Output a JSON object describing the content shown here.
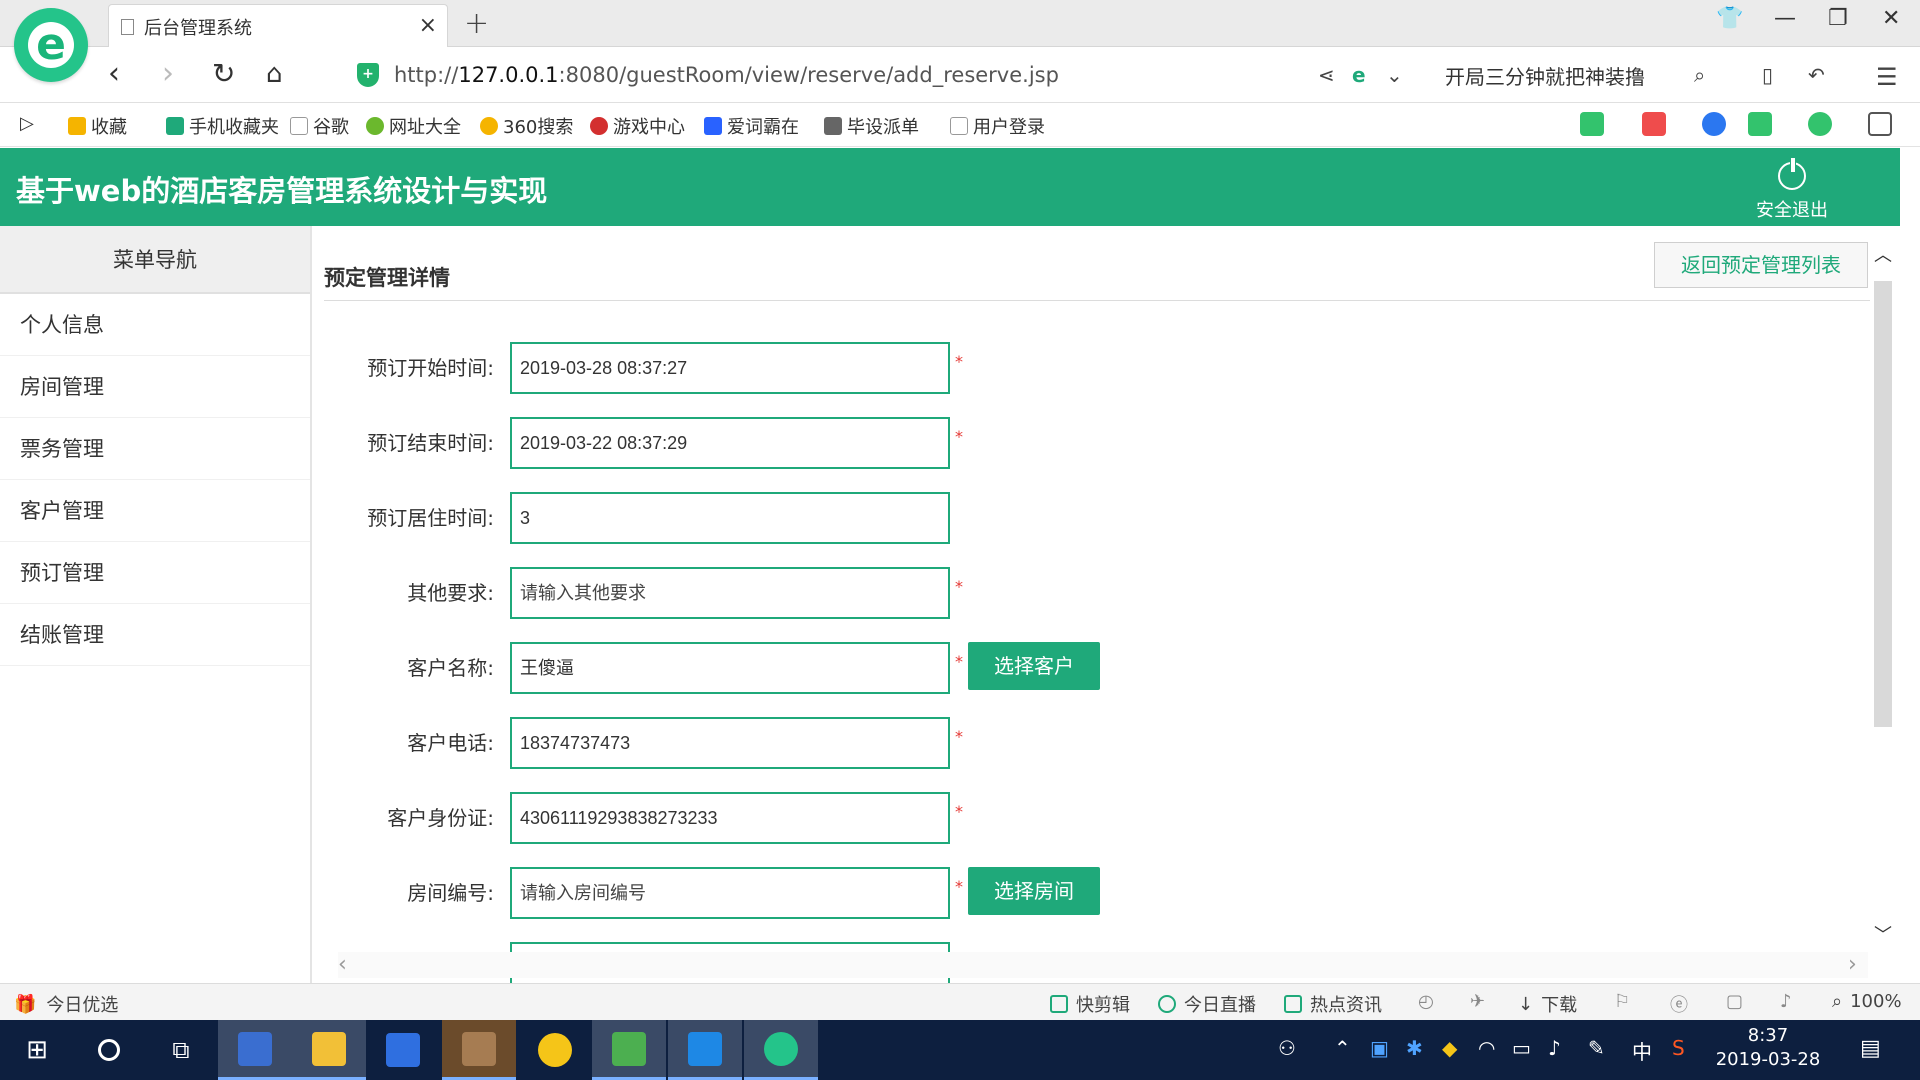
{
  "browser": {
    "tab_title": "后台管理系统",
    "url_prefix": "http://",
    "url_host": "127.0.0.1",
    "url_rest": ":8080/guestRoom/view/reserve/add_reserve.jsp",
    "promo_text": "开局三分钟就把神装撸",
    "favorites": [
      "收藏",
      "手机收藏夹",
      "谷歌",
      "网址大全",
      "360搜索",
      "游戏中心",
      "爱词霸在",
      "毕设派单",
      "用户登录"
    ]
  },
  "app": {
    "title": "基于web的酒店客房管理系统设计与实现",
    "logout_label": "安全退出"
  },
  "sidebar": {
    "header": "菜单导航",
    "items": [
      "个人信息",
      "房间管理",
      "票务管理",
      "客户管理",
      "预订管理",
      "结账管理"
    ]
  },
  "main": {
    "page_title": "预定管理详情",
    "back_button": "返回预定管理列表",
    "required_mark": "*",
    "fields": {
      "start_time": {
        "label": "预订开始时间:",
        "value": "2019-03-28 08:37:27"
      },
      "end_time": {
        "label": "预订结束时间:",
        "value": "2019-03-22 08:37:29"
      },
      "stay_time": {
        "label": "预订居住时间:",
        "value": "3"
      },
      "other_req": {
        "label": "其他要求:",
        "placeholder": "请输入其他要求"
      },
      "customer_name": {
        "label": "客户名称:",
        "value": "王傻逼"
      },
      "customer_phone": {
        "label": "客户电话:",
        "value": "18374737473"
      },
      "customer_id": {
        "label": "客户身份证:",
        "value": "430611192938382732​33"
      },
      "room_no": {
        "label": "房间编号:",
        "placeholder": "请输入房间编号"
      }
    },
    "select_customer_button": "选择客户",
    "select_room_button": "选择房间"
  },
  "statusbar": {
    "left": "今日优选",
    "items": [
      "快剪辑",
      "今日直播",
      "热点资讯",
      "下载"
    ],
    "zoom": "100%"
  },
  "taskbar": {
    "ime": "中",
    "time": "8:37",
    "date": "2019-03-28"
  },
  "colors": {
    "accent": "#1fa97a",
    "required": "#e53935",
    "taskbar": "#0d1f3f"
  }
}
